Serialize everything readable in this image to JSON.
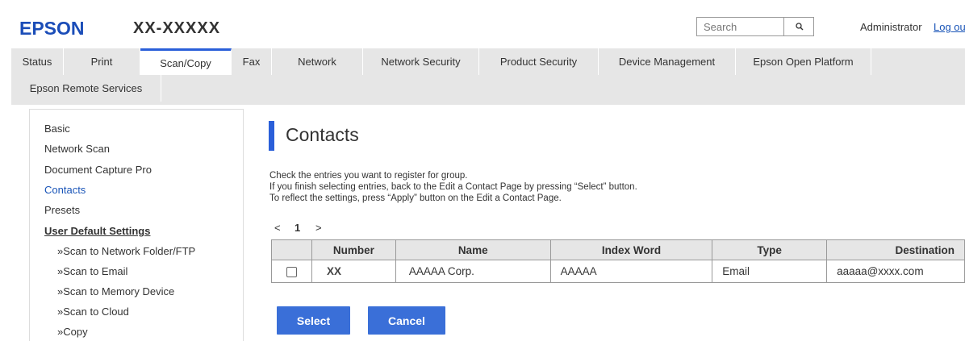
{
  "header": {
    "logo": "EPSON",
    "model": "XX-XXXXX",
    "search_placeholder": "Search",
    "user": "Administrator",
    "logout": "Log out"
  },
  "tabs": [
    {
      "label": "Status"
    },
    {
      "label": "Print"
    },
    {
      "label": "Scan/Copy",
      "active": true
    },
    {
      "label": "Fax"
    },
    {
      "label": "Network"
    },
    {
      "label": "Network Security"
    },
    {
      "label": "Product Security"
    },
    {
      "label": "Device Management"
    },
    {
      "label": "Epson Open Platform"
    },
    {
      "label": "Epson Remote Services"
    }
  ],
  "sidebar": {
    "items": [
      {
        "label": "Basic"
      },
      {
        "label": "Network Scan"
      },
      {
        "label": "Document Capture Pro"
      },
      {
        "label": "Contacts",
        "active": true
      },
      {
        "label": "Presets"
      },
      {
        "label": "User Default Settings"
      },
      {
        "label": "»Scan to Network Folder/FTP"
      },
      {
        "label": "»Scan to Email"
      },
      {
        "label": "»Scan to Memory Device"
      },
      {
        "label": "»Scan to Cloud"
      },
      {
        "label": "»Copy"
      }
    ]
  },
  "main": {
    "title": "Contacts",
    "description": [
      "Check the entries you want to register for group.",
      "If you finish selecting entries, back to the Edit a Contact Page by pressing “Select” button.",
      "To reflect the settings, press “Apply” button on the Edit a Contact Page."
    ],
    "pager": {
      "prev": "<",
      "current": "1",
      "next": ">"
    },
    "table": {
      "columns": [
        "",
        "Number",
        "Name",
        "Index Word",
        "Type",
        "Destination"
      ],
      "rows": [
        {
          "checked": false,
          "number": "XX",
          "name": "AAAAA Corp.",
          "index_word": "AAAAA",
          "type": "Email",
          "destination": "aaaaa@xxxx.com"
        }
      ]
    },
    "buttons": {
      "select": "Select",
      "cancel": "Cancel"
    }
  },
  "colors": {
    "brand": "#1b4db8",
    "accent": "#2a5fd9",
    "button": "#3a6fd8",
    "link": "#1a55b8"
  }
}
